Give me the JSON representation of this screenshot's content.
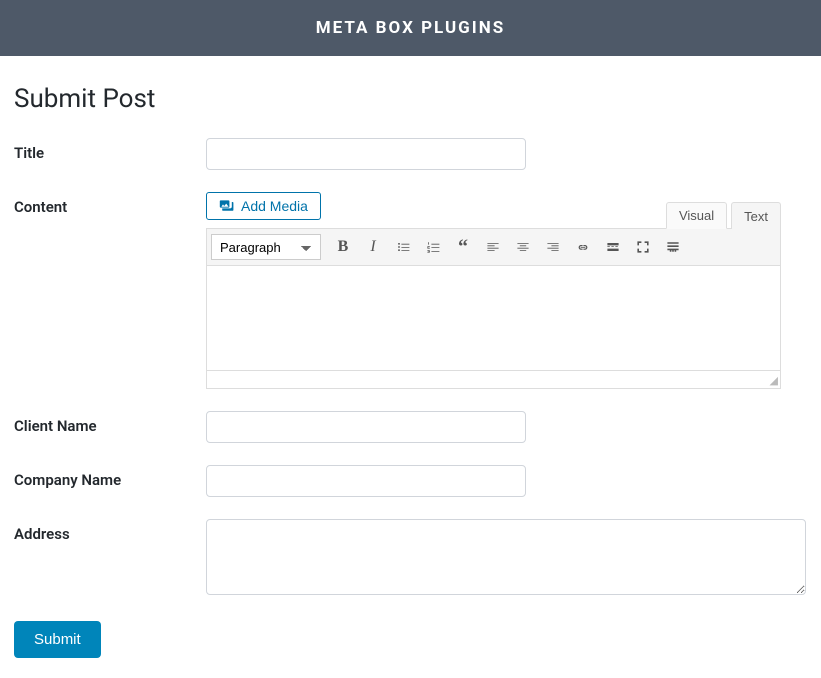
{
  "header": {
    "title": "META BOX PLUGINS"
  },
  "page": {
    "title": "Submit Post"
  },
  "form": {
    "title": {
      "label": "Title",
      "value": ""
    },
    "content": {
      "label": "Content",
      "add_media_label": "Add Media",
      "tabs": {
        "visual": "Visual",
        "text": "Text"
      },
      "format_select": "Paragraph",
      "value": ""
    },
    "client_name": {
      "label": "Client Name",
      "value": ""
    },
    "company_name": {
      "label": "Company Name",
      "value": ""
    },
    "address": {
      "label": "Address",
      "value": ""
    },
    "submit_label": "Submit"
  },
  "toolbar_icons": [
    "bold-icon",
    "italic-icon",
    "bullet-list-icon",
    "numbered-list-icon",
    "blockquote-icon",
    "align-left-icon",
    "align-center-icon",
    "align-right-icon",
    "link-icon",
    "read-more-icon",
    "fullscreen-icon",
    "toolbar-toggle-icon"
  ]
}
